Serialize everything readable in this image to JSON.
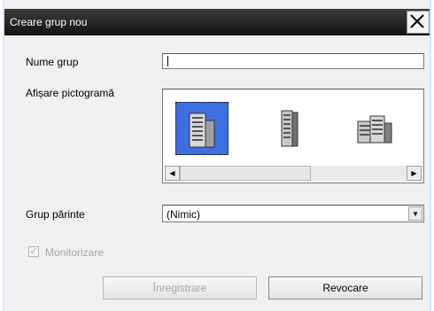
{
  "dialog": {
    "title": "Creare grup nou",
    "close_icon": "close-icon"
  },
  "form": {
    "group_name_label": "Nume grup",
    "group_name_value": "",
    "icon_display_label": "Afișare pictogramă",
    "icons": [
      "building-icon-selected",
      "tower-building-icon",
      "office-building-icon"
    ],
    "parent_group_label": "Grup părinte",
    "parent_group_value": "(Nimic)",
    "monitoring_label": "Monitorizare",
    "monitoring_checked": true
  },
  "buttons": {
    "save_label": "Înregistrare",
    "cancel_label": "Revocare"
  },
  "colors": {
    "titlebar": "#1e1e1e",
    "selection": "#3d6fe0",
    "disabled_text": "#a8a8a8"
  }
}
